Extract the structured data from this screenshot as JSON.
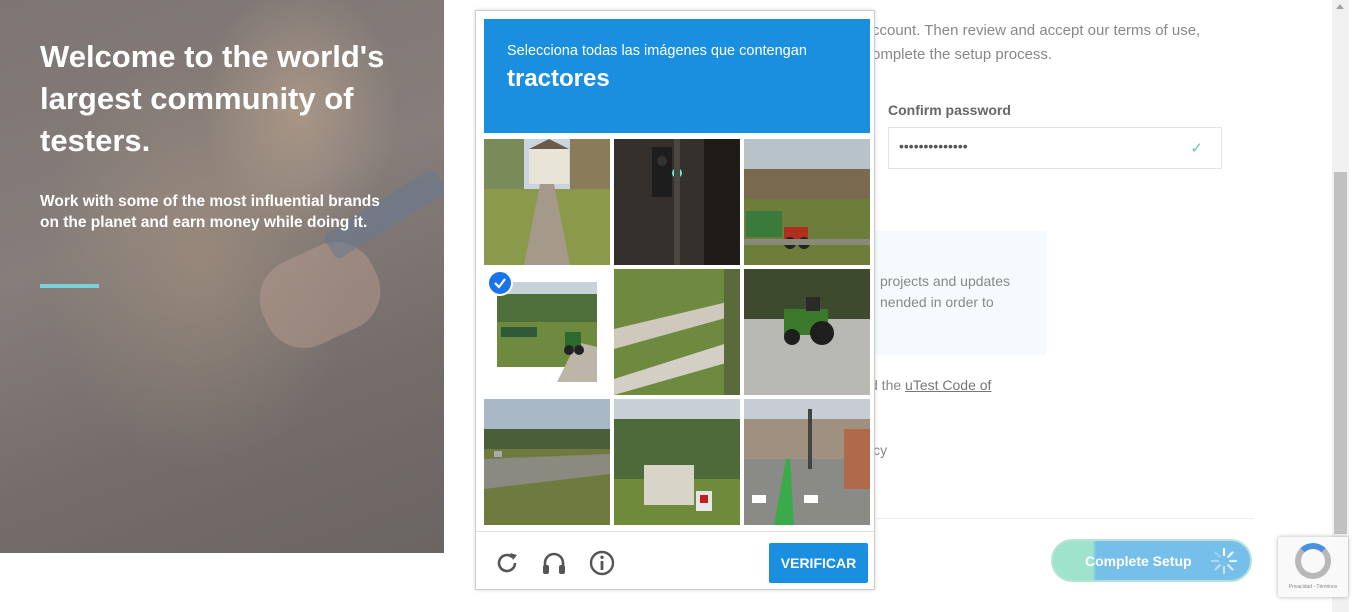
{
  "hero": {
    "title": "Welcome to the world's largest community of testers.",
    "subtitle": "Work with some of the most influential brands on the planet and earn money while doing it."
  },
  "form": {
    "intro_line1": "ccount. Then review and accept our terms of use,",
    "intro_line2": "omplete the setup process.",
    "confirm_password_label": "Confirm password",
    "confirm_password_value": "••••••••••••••",
    "info_text": "projects and updates nended in order to",
    "agree_prefix": "d the ",
    "agree_link": "uTest Code of",
    "policy_text": "icy",
    "complete_button": "Complete Setup"
  },
  "captcha": {
    "instruction": "Selecciona todas las imágenes que contengan",
    "target": "tractores",
    "verify_button": "VERIFICAR",
    "tiles": [
      {
        "id": 1,
        "selected": false
      },
      {
        "id": 2,
        "selected": false
      },
      {
        "id": 3,
        "selected": false
      },
      {
        "id": 4,
        "selected": true
      },
      {
        "id": 5,
        "selected": false
      },
      {
        "id": 6,
        "selected": false
      },
      {
        "id": 7,
        "selected": false
      },
      {
        "id": 8,
        "selected": false
      },
      {
        "id": 9,
        "selected": false
      }
    ],
    "icons": [
      "reload-icon",
      "headphones-icon",
      "info-icon"
    ]
  },
  "recaptcha_badge": {
    "text": "Privacidad - Términos"
  },
  "colors": {
    "captcha_blue": "#1a8fe0",
    "accent_line": "#7ecfdc",
    "check_green": "#5cc9b0"
  }
}
